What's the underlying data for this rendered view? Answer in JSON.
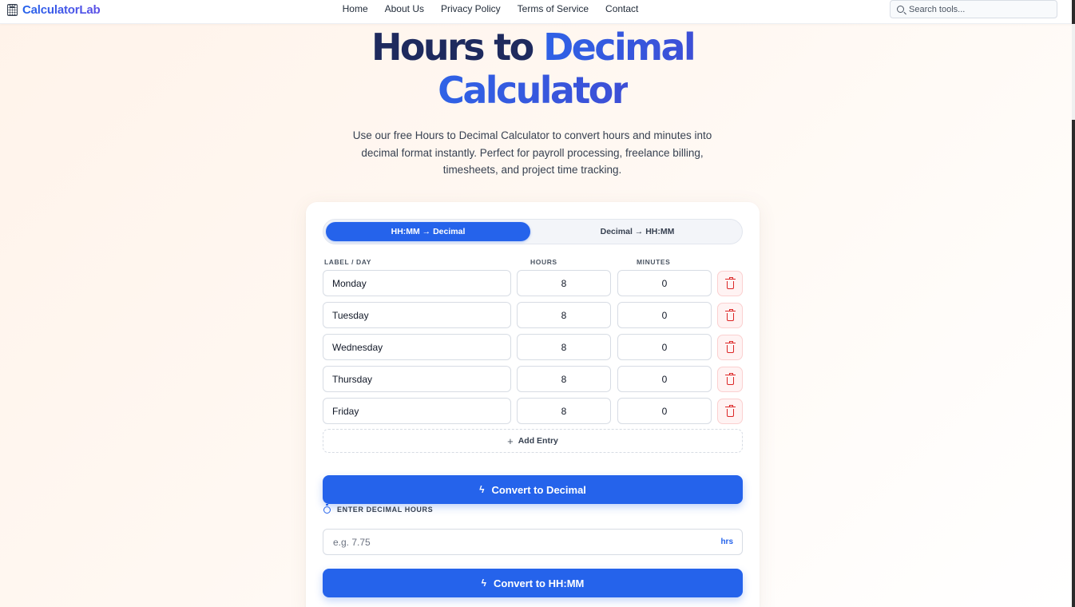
{
  "header": {
    "logo_text": "CalculatorLab",
    "nav": [
      "Home",
      "About Us",
      "Privacy Policy",
      "Terms of Service",
      "Contact"
    ],
    "search_placeholder": "Search tools..."
  },
  "hero": {
    "title_part1": "Hours to",
    "title_part2": "Decimal",
    "title_line2": "Calculator",
    "description": "Use our free Hours to Decimal Calculator to convert hours and minutes into decimal format instantly. Perfect for payroll processing, freelance billing, timesheets, and project time tracking."
  },
  "calculator": {
    "tabs": [
      {
        "label": "HH:MM → Decimal",
        "active": true
      },
      {
        "label": "Decimal → HH:MM",
        "active": false
      }
    ],
    "columns": {
      "label": "LABEL / DAY",
      "hours": "HOURS",
      "minutes": "MINUTES"
    },
    "entries": [
      {
        "label": "Monday",
        "hours": "8",
        "minutes": "0"
      },
      {
        "label": "Tuesday",
        "hours": "8",
        "minutes": "0"
      },
      {
        "label": "Wednesday",
        "hours": "8",
        "minutes": "0"
      },
      {
        "label": "Thursday",
        "hours": "8",
        "minutes": "0"
      },
      {
        "label": "Friday",
        "hours": "8",
        "minutes": "0"
      }
    ],
    "add_entry_label": "Add Entry",
    "convert_decimal_label": "Convert to Decimal",
    "decimal_section_label": "ENTER DECIMAL HOURS",
    "decimal_placeholder": "e.g. 7.75",
    "decimal_suffix": "hrs",
    "convert_hhmm_label": "Convert to HH:MM"
  },
  "colors": {
    "accent": "#2563eb",
    "title_dark": "#1e2a5e",
    "danger": "#dc2626"
  }
}
